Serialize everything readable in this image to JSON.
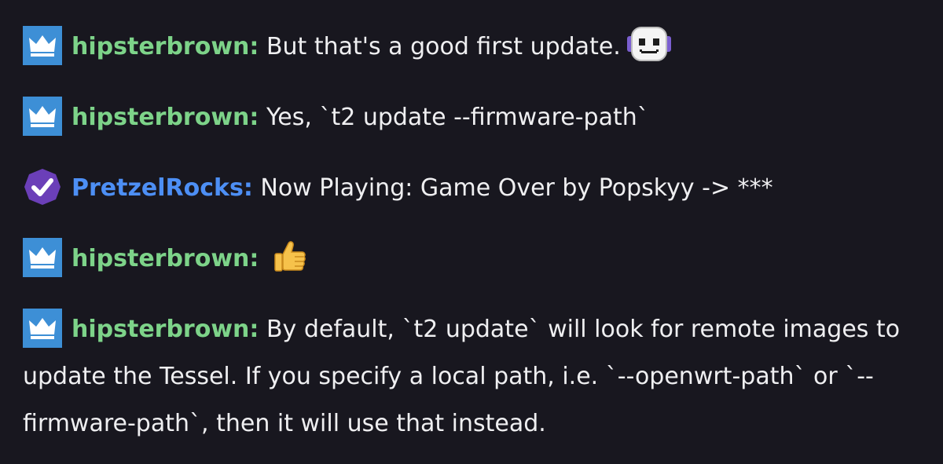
{
  "colors": {
    "background": "#18171f",
    "text": "#efeff1",
    "username_green": "#7dd389",
    "username_blue": "#4d8ff5",
    "crown_badge_bg": "#3d8fd6",
    "verified_badge_bg": "#6b3fb8"
  },
  "messages": [
    {
      "badge": "crown-icon",
      "username": "hipsterbrown",
      "separator": ":",
      "text": " But that's a good first update.",
      "emote": "robot-face-emote"
    },
    {
      "badge": "crown-icon",
      "username": "hipsterbrown",
      "separator": ":",
      "text": " Yes, `t2 update --firmware-path`"
    },
    {
      "badge": "verified-check-icon",
      "username": "PretzelRocks",
      "separator": ":",
      "text": " Now Playing: Game Over by Popskyy -> ***"
    },
    {
      "badge": "crown-icon",
      "username": "hipsterbrown",
      "separator": ":",
      "text": " ",
      "emote": "thumbs-up-emoji"
    },
    {
      "badge": "crown-icon",
      "username": "hipsterbrown",
      "separator": ":",
      "text": " By default, `t2 update` will look for remote images to update the Tessel. If you specify a local path, i.e. `--openwrt-path` or `--firmware-path`, then it will use that instead."
    }
  ]
}
